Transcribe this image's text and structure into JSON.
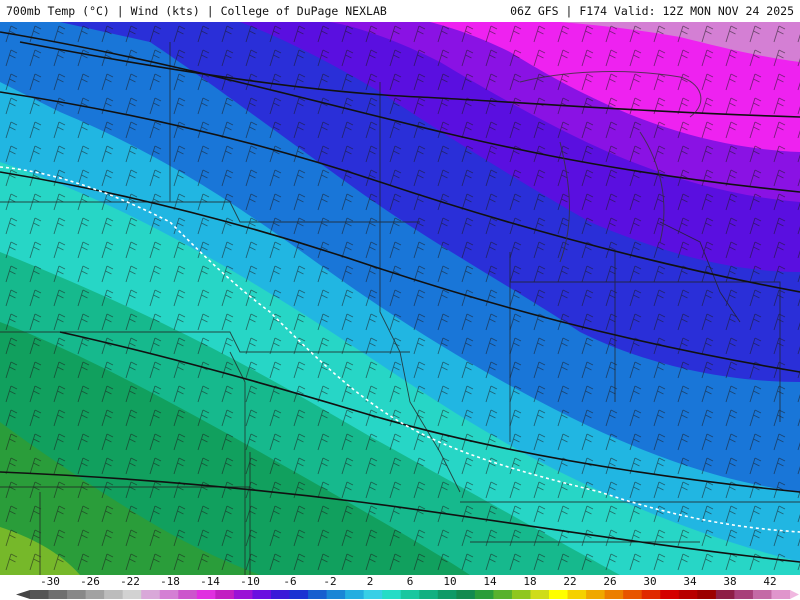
{
  "header": {
    "title_left": "700mb Temp (°C) | Wind (kts) | College of DuPage NEXLAB",
    "title_right": "06Z GFS | F174 Valid: 12Z MON NOV 24 2025"
  },
  "legend": {
    "min": -32,
    "max": 44,
    "step": 2,
    "tick_labels": [
      "-30",
      "-26",
      "-22",
      "-18",
      "-14",
      "-10",
      "-6",
      "-2",
      "2",
      "6",
      "10",
      "14",
      "18",
      "22",
      "26",
      "30",
      "34",
      "38",
      "42"
    ],
    "tick_values": [
      -30,
      -26,
      -22,
      -18,
      -14,
      -10,
      -6,
      -2,
      2,
      6,
      10,
      14,
      18,
      22,
      26,
      30,
      34,
      38,
      42
    ],
    "colors": [
      "#555555",
      "#6f6f6f",
      "#888888",
      "#a2a2a2",
      "#bcbcbc",
      "#d2d2d2",
      "#d9a8d9",
      "#d47fd4",
      "#cc55cc",
      "#e02fe0",
      "#c21ec2",
      "#9a12d6",
      "#6a0fe0",
      "#3a1ad8",
      "#1b33d2",
      "#165fcf",
      "#1a86d6",
      "#24aee0",
      "#38cfe6",
      "#25dcc6",
      "#19c79f",
      "#12b081",
      "#0f9a67",
      "#138a4f",
      "#2a9d3a",
      "#58b22d",
      "#8fc71f",
      "#cfdc1a",
      "#ffff00",
      "#f5d100",
      "#f0a800",
      "#ec7e00",
      "#e85400",
      "#e02a00",
      "#d40000",
      "#b80000",
      "#9c0000",
      "#8e1e46",
      "#a8407a",
      "#c46aa6",
      "#e095cc"
    ]
  },
  "map": {
    "description_colors": {
      "magenta": "#ee22f0",
      "purple": "#8a12e4",
      "violet": "#5a0fe0",
      "blue": "#2a2fd8",
      "medium_blue": "#1976d8",
      "cyan": "#21b6e2",
      "aqua": "#27d6c6",
      "teal": "#16b98d",
      "green": "#11a05e",
      "dark_green": "#0e8a4a",
      "lime": "#76b82a"
    }
  }
}
